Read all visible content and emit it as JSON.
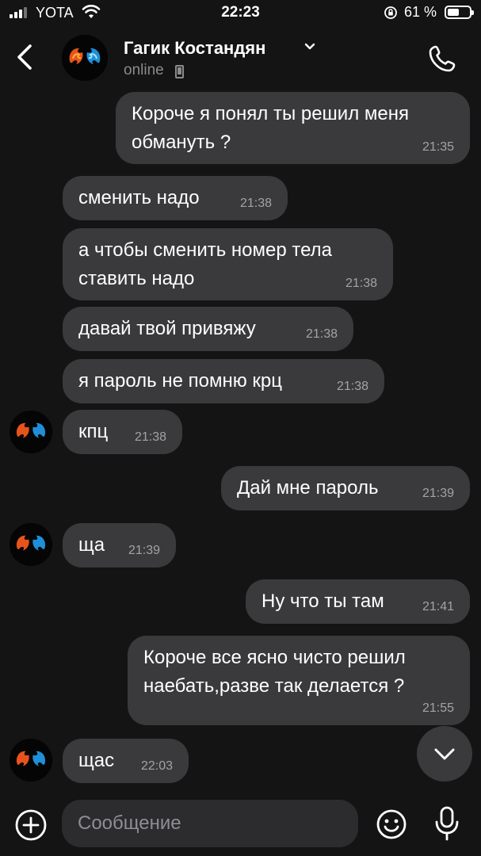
{
  "status_bar": {
    "carrier": "YOTA",
    "time": "22:23",
    "battery_percent": "61 %",
    "battery_level": 0.61,
    "icons": [
      "signal-icon",
      "wifi-icon",
      "orientation-lock-icon",
      "battery-icon"
    ]
  },
  "header": {
    "contact_name": "Гагик Костандян",
    "status": "online",
    "icons": [
      "back-icon",
      "avatar",
      "chevron-down-icon",
      "mobile-device-icon",
      "phone-call-icon"
    ]
  },
  "messages": [
    {
      "direction": "out",
      "text": "Короче я понял ты решил меня обмануть ?",
      "time": "21:35"
    },
    {
      "direction": "in",
      "text": "сменить надо",
      "time": "21:38"
    },
    {
      "direction": "in",
      "text": "а чтобы сменить номер тела ставить надо",
      "time": "21:38"
    },
    {
      "direction": "in",
      "text": "давай твой привяжу",
      "time": "21:38"
    },
    {
      "direction": "in",
      "text": "я пароль не помню крц",
      "time": "21:38"
    },
    {
      "direction": "in",
      "text": "кпц",
      "time": "21:38",
      "avatar": true
    },
    {
      "direction": "out",
      "text": "Дай мне пароль",
      "time": "21:39"
    },
    {
      "direction": "in",
      "text": "ща",
      "time": "21:39",
      "avatar": true
    },
    {
      "direction": "out",
      "text": "Ну что ты там",
      "time": "21:41"
    },
    {
      "direction": "out",
      "text": "Короче все ясно чисто решил наебать,разве так делается ?",
      "time": "21:55"
    },
    {
      "direction": "in",
      "text": "щас",
      "time": "22:03",
      "avatar": true
    }
  ],
  "input": {
    "placeholder": "Сообщение",
    "icons": [
      "plus-circle-icon",
      "emoji-icon",
      "microphone-icon",
      "chevron-down-icon"
    ]
  },
  "colors": {
    "background": "#141414",
    "bubble": "#3a3a3c",
    "input_field": "#2c2c2e",
    "secondary_text": "#8b8b8b"
  }
}
